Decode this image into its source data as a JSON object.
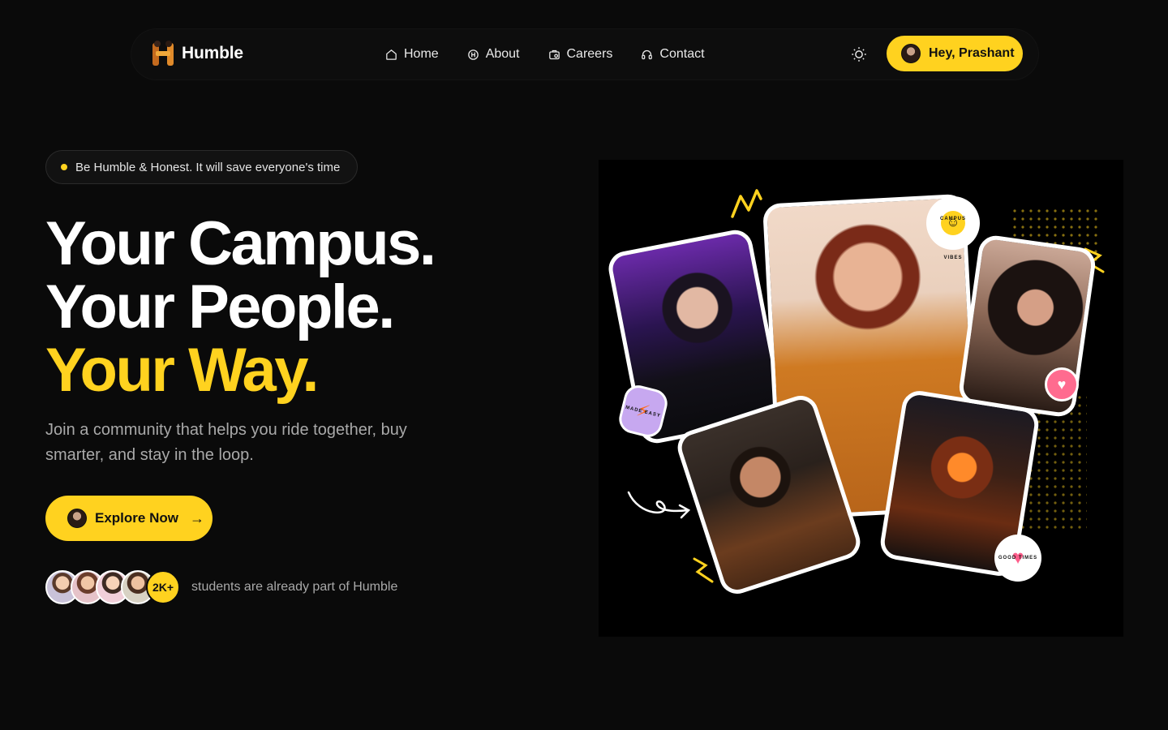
{
  "brand": {
    "name": "Humble"
  },
  "nav": {
    "items": [
      {
        "label": "Home",
        "icon": "home-icon"
      },
      {
        "label": "About",
        "icon": "about-icon"
      },
      {
        "label": "Careers",
        "icon": "briefcase-icon"
      },
      {
        "label": "Contact",
        "icon": "headset-icon"
      }
    ],
    "theme_icon": "sun-icon",
    "user_greeting": "Hey, Prashant"
  },
  "hero": {
    "tagline": "Be Humble & Honest. It will save everyone's time",
    "headline_line1": "Your Campus.",
    "headline_line2": "Your People.",
    "headline_line3": "Your Way.",
    "subtext": "Join a community that helps you ride together, buy smarter, and stay in the loop.",
    "cta_label": "Explore Now",
    "cta_arrow": "→",
    "member_count": "2K+",
    "social_proof": "students are already part of Humble"
  },
  "collage": {
    "stickers": [
      {
        "text": "CAMPUS VIBES"
      },
      {
        "text": "MADE EASY"
      },
      {
        "text": "GOOD TIMES"
      }
    ]
  },
  "colors": {
    "accent": "#FFD21F",
    "background": "#0a0a0a",
    "muted_text": "#a9a9a9"
  }
}
